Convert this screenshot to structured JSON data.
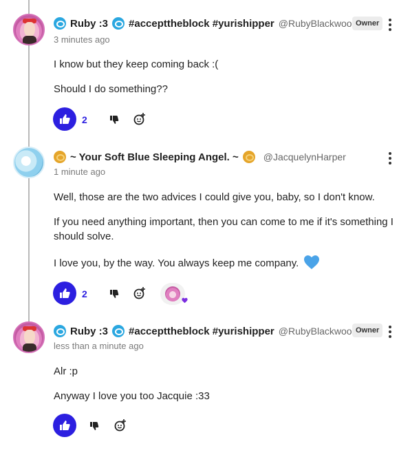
{
  "comments": [
    {
      "name": "Ruby :3",
      "hashtags": "#accepttheblock #yurishipper",
      "handle": "@RubyBlackwood",
      "badge": "Owner",
      "time": "3 minutes ago",
      "paragraphs": [
        "I know but they keep coming back :(",
        "Should I do something??"
      ],
      "likes": "2"
    },
    {
      "name": "~ Your Soft Blue Sleeping Angel. ~",
      "handle": "@JacquelynHarper",
      "time": "1 minute ago",
      "paragraphs": [
        "Well, those are the two advices I could give you, baby, so I don't know.",
        "If you need anything important, then you can come to me if it's something I should solve.",
        "I love you, by the way. You always keep me company."
      ],
      "likes": "2"
    },
    {
      "name": "Ruby :3",
      "hashtags": "#accepttheblock #yurishipper",
      "handle": "@RubyBlackwood",
      "badge": "Owner",
      "time": "less than a minute ago",
      "paragraphs": [
        "Alr :p",
        "Anyway I love you too Jacquie :33"
      ]
    }
  ],
  "icons": {
    "name_badge_1": "paw-badge-icon",
    "name_badge_2": "coin-badge-icon",
    "like": "thumbs-up-icon",
    "dislike": "thumbs-down-icon",
    "react": "add-reaction-icon",
    "heart_emoji": "blue-heart-icon",
    "reaction_heart": "purple-heart-icon"
  },
  "colors": {
    "accent": "#2c1fe0",
    "heart_emoji": "#4aa3e8",
    "reaction_heart": "#7b2ee0",
    "badge_bg": "#ececec"
  }
}
